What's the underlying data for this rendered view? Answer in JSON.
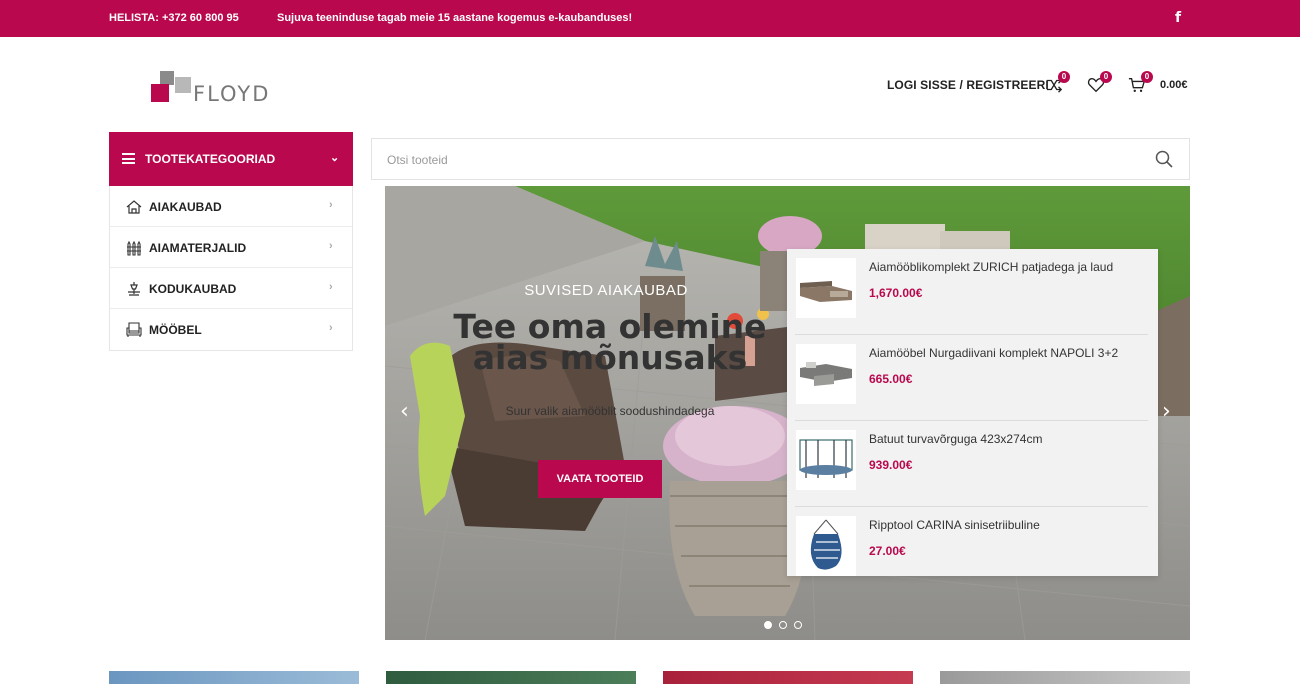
{
  "topbar": {
    "phone": "HELISTA: +372 60 800 95",
    "promo": "Sujuva teeninduse tagab meie 15 aastane kogemus e-kaubanduses!",
    "facebook_glyph": "f"
  },
  "header": {
    "logo_text": "FLOYD",
    "login_label": "LOGI SISSE / REGISTREERI",
    "compare_count": "0",
    "wishlist_count": "0",
    "cart_count": "0",
    "cart_total": "0.00€"
  },
  "categories": {
    "title": "TOOTEKATEGOORIAD",
    "chevron": "⌄",
    "items": [
      {
        "label": "AIAKAUBAD",
        "icon": "garden-house-icon"
      },
      {
        "label": "AIAMATERJALID",
        "icon": "fence-icon"
      },
      {
        "label": "KODUKAUBAD",
        "icon": "lamp-icon"
      },
      {
        "label": "MÖÖBEL",
        "icon": "furniture-icon"
      }
    ],
    "arrow": "›"
  },
  "search": {
    "placeholder": "Otsi tooteid"
  },
  "hero": {
    "kicker": "SUVISED AIAKAUBAD",
    "headline": "Tee oma olemine aias mõnusaks",
    "subtitle": "Suur valik aiamööblit soodushindadega",
    "cta": "VAATA TOOTEID",
    "prev": "‹",
    "next": "›",
    "slides": 3,
    "active_slide": 1
  },
  "search_results": [
    {
      "name": "Aiamööblikomplekt ZURICH patjadega ja laud",
      "price": "1,670.00€",
      "thumb": "sofa-set-thumb"
    },
    {
      "name": "Aiamööbel Nurgadiivani komplekt NAPOLI 3+2",
      "price": "665.00€",
      "thumb": "corner-sofa-thumb"
    },
    {
      "name": "Batuut turvavõrguga 423x274cm",
      "price": "939.00€",
      "thumb": "trampoline-thumb"
    },
    {
      "name": "Ripptool CARINA sinisetriibuline",
      "price": "27.00€",
      "thumb": "hanging-chair-thumb"
    }
  ],
  "colors": {
    "brand": "#b9084d",
    "text": "#333333",
    "border": "#e6e6e6",
    "dropdown_bg": "#f2f2f2"
  }
}
